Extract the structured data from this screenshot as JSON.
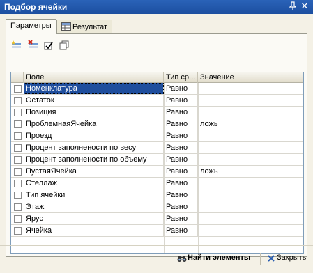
{
  "window": {
    "title": "Подбор ячейки"
  },
  "tabs": [
    {
      "label": "Параметры"
    },
    {
      "label": "Результат"
    }
  ],
  "toolbar_icons": [
    "add-row-icon",
    "delete-row-icon",
    "check-all-icon",
    "copy-icon"
  ],
  "grid": {
    "columns": [
      "Поле",
      "Тип ср...",
      "Значение"
    ],
    "rows": [
      {
        "field": "Номенклатура",
        "type": "Равно",
        "value": "",
        "checked": false,
        "selected": true
      },
      {
        "field": "Остаток",
        "type": "Равно",
        "value": "",
        "checked": false
      },
      {
        "field": "Позиция",
        "type": "Равно",
        "value": "",
        "checked": false
      },
      {
        "field": "ПроблемнаяЯчейка",
        "type": "Равно",
        "value": "ложь",
        "checked": false
      },
      {
        "field": "Проезд",
        "type": "Равно",
        "value": "",
        "checked": false
      },
      {
        "field": "Процент заполнености по весу",
        "type": "Равно",
        "value": "",
        "checked": false
      },
      {
        "field": "Процент заполнености по объему",
        "type": "Равно",
        "value": "",
        "checked": false
      },
      {
        "field": "ПустаяЯчейка",
        "type": "Равно",
        "value": "ложь",
        "checked": false
      },
      {
        "field": "Стеллаж",
        "type": "Равно",
        "value": "",
        "checked": false
      },
      {
        "field": "Тип ячейки",
        "type": "Равно",
        "value": "",
        "checked": false
      },
      {
        "field": "Этаж",
        "type": "Равно",
        "value": "",
        "checked": false
      },
      {
        "field": "Ярус",
        "type": "Равно",
        "value": "",
        "checked": false
      },
      {
        "field": "Ячейка",
        "type": "Равно",
        "value": "",
        "checked": false
      }
    ]
  },
  "buttons": {
    "find": "Найти элементы",
    "close": "Закрыть"
  },
  "colors": {
    "titlebar": "#1c4fa0",
    "selection": "#1f4e9d"
  }
}
